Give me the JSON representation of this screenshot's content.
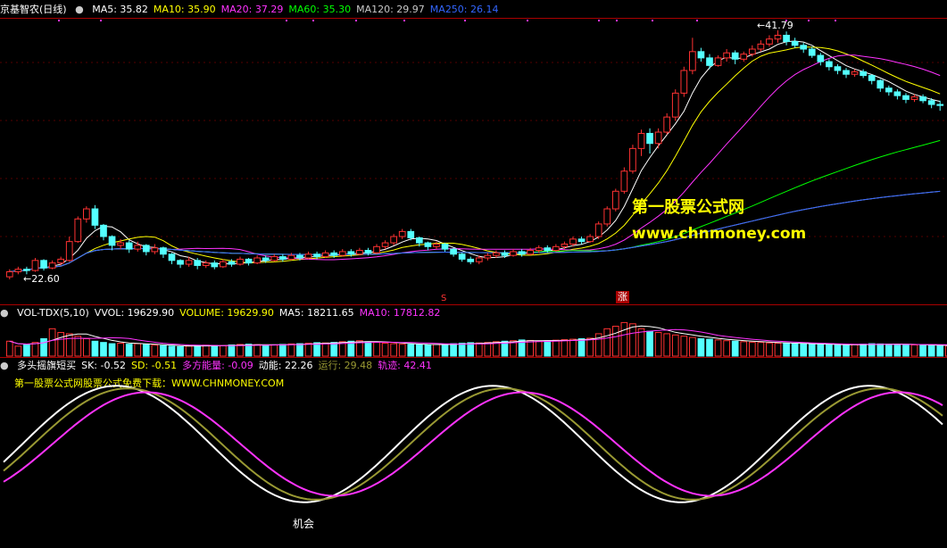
{
  "main_panel": {
    "stock_name": "京基智农(日线)",
    "indicators": [
      {
        "label": "MA5: 35.82",
        "color": "#ffffff"
      },
      {
        "label": "MA10: 35.90",
        "color": "#ffff00"
      },
      {
        "label": "MA20: 37.29",
        "color": "#ff33ff"
      },
      {
        "label": "MA60: 35.30",
        "color": "#00ff00"
      },
      {
        "label": "MA120: 29.97",
        "color": "#c8c8c8"
      },
      {
        "label": "MA250: 26.14",
        "color": "#3366ff"
      }
    ],
    "high_label": "41.79",
    "low_label": "22.60",
    "signal_s": "S",
    "signal_zhang": "涨",
    "watermark_cn": "第一股票公式网",
    "watermark_url": "www.chnmoney.com"
  },
  "volume_panel": {
    "indicators": [
      {
        "label": "VOL-TDX(5,10)",
        "color": "#ffffff"
      },
      {
        "label": "VVOL: 19629.90",
        "color": "#ffffff"
      },
      {
        "label": "VOLUME: 19629.90",
        "color": "#ffff00"
      },
      {
        "label": "MA5: 18211.65",
        "color": "#ffffff"
      },
      {
        "label": "MA10: 17812.82",
        "color": "#ff33ff"
      }
    ]
  },
  "osc_panel": {
    "indicators": [
      {
        "label": "多头摇旗短买",
        "color": "#ffffff"
      },
      {
        "label": "SK: -0.52",
        "color": "#ffffff"
      },
      {
        "label": "SD: -0.51",
        "color": "#ffff00"
      },
      {
        "label": "多方能量: -0.09",
        "color": "#ff33ff"
      },
      {
        "label": "动能: 22.26",
        "color": "#ffffff"
      },
      {
        "label": "运行: 29.48",
        "color": "#999933"
      },
      {
        "label": "轨迹: 42.41",
        "color": "#ff33ff"
      }
    ],
    "subtitle": "第一股票公式网股票公式免费下载：WWW.CHNMONEY.COM",
    "opportunity_label": "机会"
  },
  "chart_data": {
    "type": "candlestick",
    "stock": "京基智农",
    "period": "日线",
    "price_high": 41.79,
    "price_low": 22.6,
    "candles": [
      [
        22.2,
        22.6,
        22.0,
        22.8
      ],
      [
        22.6,
        22.8,
        22.4,
        23.0
      ],
      [
        22.8,
        22.7,
        22.4,
        23.0
      ],
      [
        22.7,
        23.5,
        22.6,
        23.7
      ],
      [
        23.5,
        22.9,
        22.7,
        23.6
      ],
      [
        22.9,
        23.3,
        22.8,
        23.5
      ],
      [
        23.3,
        23.6,
        23.1,
        23.8
      ],
      [
        23.5,
        25.0,
        23.4,
        25.4
      ],
      [
        25.0,
        26.8,
        24.9,
        27.0
      ],
      [
        26.8,
        27.6,
        26.5,
        27.8
      ],
      [
        27.6,
        26.3,
        26.0,
        27.9
      ],
      [
        26.3,
        25.4,
        25.1,
        26.4
      ],
      [
        25.4,
        24.7,
        24.3,
        25.5
      ],
      [
        24.7,
        24.9,
        24.4,
        25.2
      ],
      [
        24.9,
        24.4,
        24.1,
        25.1
      ],
      [
        24.4,
        24.7,
        24.2,
        25.0
      ],
      [
        24.7,
        24.2,
        23.9,
        24.8
      ],
      [
        24.2,
        24.5,
        24.0,
        24.8
      ],
      [
        24.5,
        24.0,
        23.7,
        24.6
      ],
      [
        24.0,
        23.5,
        23.2,
        24.1
      ],
      [
        23.5,
        23.2,
        22.9,
        23.6
      ],
      [
        23.2,
        23.5,
        23.0,
        23.8
      ],
      [
        23.5,
        23.1,
        22.8,
        23.7
      ],
      [
        23.1,
        23.3,
        22.9,
        23.5
      ],
      [
        23.3,
        23.0,
        22.8,
        23.5
      ],
      [
        23.0,
        23.4,
        22.9,
        23.6
      ],
      [
        23.4,
        23.2,
        23.0,
        23.6
      ],
      [
        23.2,
        23.6,
        23.1,
        23.8
      ],
      [
        23.6,
        23.3,
        23.1,
        23.7
      ],
      [
        23.3,
        23.7,
        23.2,
        23.9
      ],
      [
        23.7,
        23.5,
        23.3,
        23.9
      ],
      [
        23.5,
        23.8,
        23.4,
        24.0
      ],
      [
        23.8,
        23.6,
        23.4,
        24.0
      ],
      [
        23.6,
        23.9,
        23.5,
        24.1
      ],
      [
        23.9,
        23.7,
        23.5,
        24.1
      ],
      [
        23.7,
        24.0,
        23.6,
        24.2
      ],
      [
        24.0,
        23.8,
        23.6,
        24.2
      ],
      [
        23.8,
        24.1,
        23.7,
        24.3
      ],
      [
        24.1,
        23.9,
        23.7,
        24.3
      ],
      [
        23.9,
        24.2,
        23.8,
        24.4
      ],
      [
        24.2,
        24.0,
        23.8,
        24.4
      ],
      [
        24.0,
        24.3,
        23.9,
        24.5
      ],
      [
        24.3,
        24.1,
        23.9,
        24.5
      ],
      [
        24.1,
        24.6,
        24.0,
        24.8
      ],
      [
        24.6,
        24.9,
        24.4,
        25.1
      ],
      [
        24.9,
        25.4,
        24.7,
        25.6
      ],
      [
        25.4,
        25.8,
        25.2,
        26.0
      ],
      [
        25.8,
        25.3,
        25.1,
        26.0
      ],
      [
        25.3,
        24.9,
        24.6,
        25.4
      ],
      [
        24.9,
        24.6,
        24.3,
        25.0
      ],
      [
        24.6,
        24.8,
        24.4,
        25.0
      ],
      [
        24.8,
        24.4,
        24.2,
        24.9
      ],
      [
        24.4,
        24.0,
        23.8,
        24.5
      ],
      [
        24.0,
        23.6,
        23.4,
        24.1
      ],
      [
        23.6,
        23.4,
        23.2,
        23.8
      ],
      [
        23.4,
        23.7,
        23.2,
        23.9
      ],
      [
        23.7,
        23.9,
        23.5,
        24.1
      ],
      [
        23.9,
        24.1,
        23.7,
        24.3
      ],
      [
        24.1,
        23.9,
        23.7,
        24.3
      ],
      [
        23.9,
        24.2,
        23.8,
        24.4
      ],
      [
        24.2,
        24.0,
        23.8,
        24.4
      ],
      [
        24.0,
        24.3,
        23.9,
        24.5
      ],
      [
        24.3,
        24.5,
        24.1,
        24.7
      ],
      [
        24.5,
        24.3,
        24.1,
        24.7
      ],
      [
        24.3,
        24.6,
        24.2,
        24.8
      ],
      [
        24.6,
        24.8,
        24.4,
        25.0
      ],
      [
        24.8,
        25.2,
        24.6,
        25.4
      ],
      [
        25.2,
        25.0,
        24.8,
        25.4
      ],
      [
        25.0,
        25.4,
        24.9,
        25.6
      ],
      [
        25.4,
        26.4,
        25.2,
        26.6
      ],
      [
        26.4,
        27.6,
        26.2,
        27.8
      ],
      [
        27.6,
        29.0,
        27.4,
        29.2
      ],
      [
        29.0,
        30.6,
        28.8,
        30.9
      ],
      [
        30.6,
        32.4,
        30.4,
        32.7
      ],
      [
        32.4,
        33.6,
        31.8,
        33.9
      ],
      [
        33.6,
        32.8,
        32.0,
        34.0
      ],
      [
        32.8,
        33.7,
        32.4,
        34.0
      ],
      [
        33.7,
        34.9,
        33.5,
        35.2
      ],
      [
        34.9,
        36.8,
        34.6,
        37.1
      ],
      [
        36.8,
        38.6,
        36.5,
        38.9
      ],
      [
        38.6,
        40.1,
        38.3,
        41.2
      ],
      [
        40.1,
        39.6,
        39.3,
        40.4
      ],
      [
        39.6,
        39.0,
        38.7,
        39.9
      ],
      [
        39.0,
        39.6,
        38.9,
        39.8
      ],
      [
        39.6,
        40.0,
        39.3,
        40.3
      ],
      [
        40.0,
        39.5,
        39.1,
        40.2
      ],
      [
        39.5,
        39.9,
        39.3,
        40.1
      ],
      [
        39.9,
        40.3,
        39.7,
        40.6
      ],
      [
        40.3,
        40.7,
        40.1,
        41.0
      ],
      [
        40.7,
        41.1,
        40.5,
        41.4
      ],
      [
        41.1,
        41.4,
        40.8,
        41.79
      ],
      [
        41.4,
        40.9,
        40.6,
        41.7
      ],
      [
        40.9,
        40.6,
        40.4,
        41.2
      ],
      [
        40.6,
        40.3,
        40.0,
        40.8
      ],
      [
        40.3,
        39.8,
        39.6,
        40.5
      ],
      [
        39.8,
        39.3,
        39.0,
        40.0
      ],
      [
        39.3,
        38.9,
        38.6,
        39.5
      ],
      [
        38.9,
        38.6,
        38.3,
        39.1
      ],
      [
        38.6,
        38.3,
        38.0,
        38.8
      ],
      [
        38.3,
        38.5,
        38.1,
        38.7
      ],
      [
        38.5,
        38.2,
        38.0,
        38.7
      ],
      [
        38.2,
        37.8,
        37.5,
        38.3
      ],
      [
        37.8,
        37.2,
        36.9,
        37.9
      ],
      [
        37.2,
        36.9,
        36.6,
        37.4
      ],
      [
        36.9,
        36.6,
        36.3,
        37.1
      ],
      [
        36.6,
        36.3,
        36.0,
        36.8
      ],
      [
        36.3,
        36.5,
        36.1,
        36.7
      ],
      [
        36.5,
        36.2,
        36.0,
        36.7
      ],
      [
        36.2,
        35.9,
        35.6,
        36.4
      ],
      [
        35.9,
        35.82,
        35.4,
        36.2
      ]
    ],
    "ma_lines": [
      "MA5",
      "MA10",
      "MA20",
      "MA60",
      "MA120",
      "MA250"
    ],
    "volume": [
      60,
      40,
      45,
      55,
      70,
      110,
      95,
      90,
      80,
      70,
      60,
      55,
      50,
      52,
      48,
      50,
      46,
      44,
      42,
      40,
      38,
      40,
      42,
      44,
      43,
      42,
      45,
      47,
      48,
      46,
      44,
      45,
      47,
      49,
      50,
      52,
      54,
      53,
      55,
      58,
      60,
      62,
      58,
      55,
      52,
      50,
      48,
      47,
      46,
      45,
      47,
      48,
      50,
      52,
      54,
      53,
      55,
      58,
      60,
      62,
      65,
      63,
      60,
      62,
      64,
      66,
      68,
      70,
      72,
      90,
      110,
      120,
      135,
      130,
      110,
      100,
      95,
      90,
      85,
      80,
      75,
      70,
      68,
      65,
      62,
      60,
      58,
      56,
      55,
      53,
      52,
      51,
      50,
      49,
      48,
      47,
      46,
      45,
      44,
      46,
      48,
      50,
      49,
      48,
      47,
      46,
      45,
      44,
      43,
      42,
      41,
      40
    ],
    "oscillator": {
      "series": [
        {
          "name": "SK"
        },
        {
          "name": "SD"
        },
        {
          "name": "轨迹"
        }
      ]
    }
  }
}
